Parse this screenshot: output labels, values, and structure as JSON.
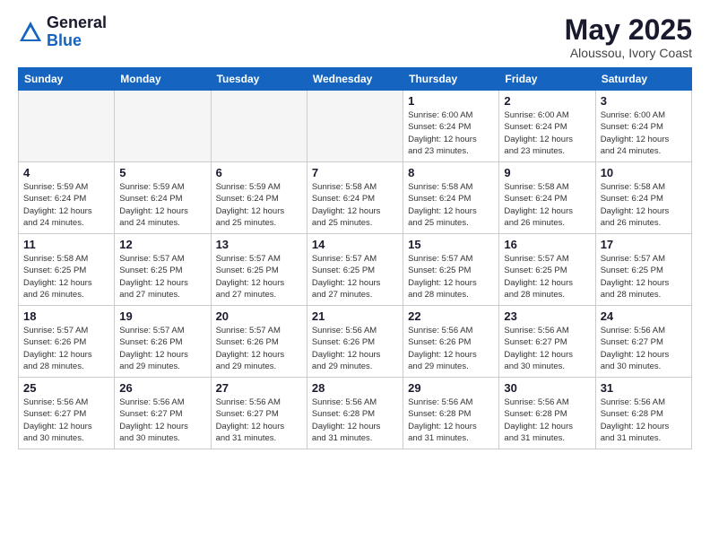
{
  "logo": {
    "general": "General",
    "blue": "Blue"
  },
  "title": "May 2025",
  "subtitle": "Aloussou, Ivory Coast",
  "days_of_week": [
    "Sunday",
    "Monday",
    "Tuesday",
    "Wednesday",
    "Thursday",
    "Friday",
    "Saturday"
  ],
  "weeks": [
    [
      {
        "day": "",
        "info": ""
      },
      {
        "day": "",
        "info": ""
      },
      {
        "day": "",
        "info": ""
      },
      {
        "day": "",
        "info": ""
      },
      {
        "day": "1",
        "info": "Sunrise: 6:00 AM\nSunset: 6:24 PM\nDaylight: 12 hours\nand 23 minutes."
      },
      {
        "day": "2",
        "info": "Sunrise: 6:00 AM\nSunset: 6:24 PM\nDaylight: 12 hours\nand 23 minutes."
      },
      {
        "day": "3",
        "info": "Sunrise: 6:00 AM\nSunset: 6:24 PM\nDaylight: 12 hours\nand 24 minutes."
      }
    ],
    [
      {
        "day": "4",
        "info": "Sunrise: 5:59 AM\nSunset: 6:24 PM\nDaylight: 12 hours\nand 24 minutes."
      },
      {
        "day": "5",
        "info": "Sunrise: 5:59 AM\nSunset: 6:24 PM\nDaylight: 12 hours\nand 24 minutes."
      },
      {
        "day": "6",
        "info": "Sunrise: 5:59 AM\nSunset: 6:24 PM\nDaylight: 12 hours\nand 25 minutes."
      },
      {
        "day": "7",
        "info": "Sunrise: 5:58 AM\nSunset: 6:24 PM\nDaylight: 12 hours\nand 25 minutes."
      },
      {
        "day": "8",
        "info": "Sunrise: 5:58 AM\nSunset: 6:24 PM\nDaylight: 12 hours\nand 25 minutes."
      },
      {
        "day": "9",
        "info": "Sunrise: 5:58 AM\nSunset: 6:24 PM\nDaylight: 12 hours\nand 26 minutes."
      },
      {
        "day": "10",
        "info": "Sunrise: 5:58 AM\nSunset: 6:24 PM\nDaylight: 12 hours\nand 26 minutes."
      }
    ],
    [
      {
        "day": "11",
        "info": "Sunrise: 5:58 AM\nSunset: 6:25 PM\nDaylight: 12 hours\nand 26 minutes."
      },
      {
        "day": "12",
        "info": "Sunrise: 5:57 AM\nSunset: 6:25 PM\nDaylight: 12 hours\nand 27 minutes."
      },
      {
        "day": "13",
        "info": "Sunrise: 5:57 AM\nSunset: 6:25 PM\nDaylight: 12 hours\nand 27 minutes."
      },
      {
        "day": "14",
        "info": "Sunrise: 5:57 AM\nSunset: 6:25 PM\nDaylight: 12 hours\nand 27 minutes."
      },
      {
        "day": "15",
        "info": "Sunrise: 5:57 AM\nSunset: 6:25 PM\nDaylight: 12 hours\nand 28 minutes."
      },
      {
        "day": "16",
        "info": "Sunrise: 5:57 AM\nSunset: 6:25 PM\nDaylight: 12 hours\nand 28 minutes."
      },
      {
        "day": "17",
        "info": "Sunrise: 5:57 AM\nSunset: 6:25 PM\nDaylight: 12 hours\nand 28 minutes."
      }
    ],
    [
      {
        "day": "18",
        "info": "Sunrise: 5:57 AM\nSunset: 6:26 PM\nDaylight: 12 hours\nand 28 minutes."
      },
      {
        "day": "19",
        "info": "Sunrise: 5:57 AM\nSunset: 6:26 PM\nDaylight: 12 hours\nand 29 minutes."
      },
      {
        "day": "20",
        "info": "Sunrise: 5:57 AM\nSunset: 6:26 PM\nDaylight: 12 hours\nand 29 minutes."
      },
      {
        "day": "21",
        "info": "Sunrise: 5:56 AM\nSunset: 6:26 PM\nDaylight: 12 hours\nand 29 minutes."
      },
      {
        "day": "22",
        "info": "Sunrise: 5:56 AM\nSunset: 6:26 PM\nDaylight: 12 hours\nand 29 minutes."
      },
      {
        "day": "23",
        "info": "Sunrise: 5:56 AM\nSunset: 6:27 PM\nDaylight: 12 hours\nand 30 minutes."
      },
      {
        "day": "24",
        "info": "Sunrise: 5:56 AM\nSunset: 6:27 PM\nDaylight: 12 hours\nand 30 minutes."
      }
    ],
    [
      {
        "day": "25",
        "info": "Sunrise: 5:56 AM\nSunset: 6:27 PM\nDaylight: 12 hours\nand 30 minutes."
      },
      {
        "day": "26",
        "info": "Sunrise: 5:56 AM\nSunset: 6:27 PM\nDaylight: 12 hours\nand 30 minutes."
      },
      {
        "day": "27",
        "info": "Sunrise: 5:56 AM\nSunset: 6:27 PM\nDaylight: 12 hours\nand 31 minutes."
      },
      {
        "day": "28",
        "info": "Sunrise: 5:56 AM\nSunset: 6:28 PM\nDaylight: 12 hours\nand 31 minutes."
      },
      {
        "day": "29",
        "info": "Sunrise: 5:56 AM\nSunset: 6:28 PM\nDaylight: 12 hours\nand 31 minutes."
      },
      {
        "day": "30",
        "info": "Sunrise: 5:56 AM\nSunset: 6:28 PM\nDaylight: 12 hours\nand 31 minutes."
      },
      {
        "day": "31",
        "info": "Sunrise: 5:56 AM\nSunset: 6:28 PM\nDaylight: 12 hours\nand 31 minutes."
      }
    ]
  ]
}
